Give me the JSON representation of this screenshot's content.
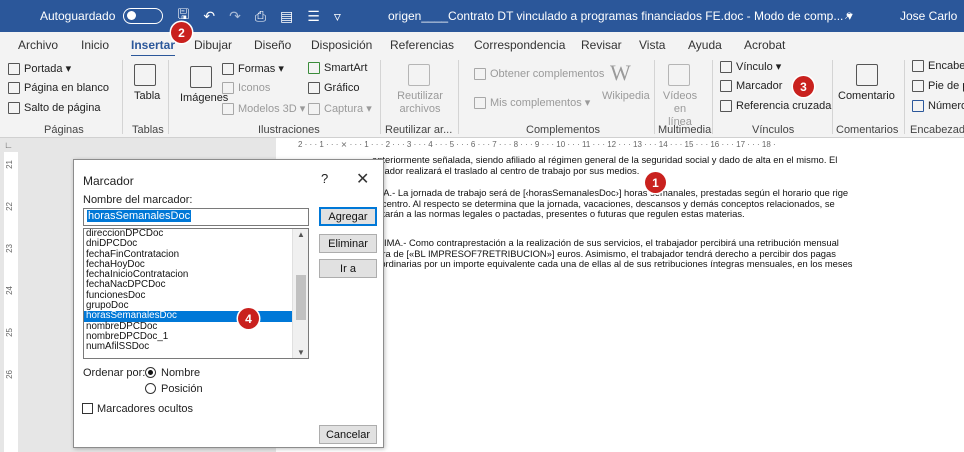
{
  "titlebar": {
    "autosave": "Autoguardado",
    "doc_title": "origen____Contrato DT vinculado a programas financiados FE.doc  -  Modo de comp...  ▾",
    "user": "Jose Carlo"
  },
  "tabs": [
    "Archivo",
    "Inicio",
    "Insertar",
    "Dibujar",
    "Diseño",
    "Disposición",
    "Referencias",
    "Correspondencia",
    "Revisar",
    "Vista",
    "Ayuda",
    "Acrobat"
  ],
  "ribbon": {
    "paginas": {
      "portada": "Portada ▾",
      "pagina_blanco": "Página en blanco",
      "salto": "Salto de página",
      "label": "Páginas"
    },
    "tablas": {
      "tabla": "Tabla",
      "label": "Tablas"
    },
    "ilustraciones": {
      "imagenes": "Imágenes",
      "formas": "Formas ▾",
      "iconos": "Iconos",
      "modelos": "Modelos 3D ▾",
      "smartart": "SmartArt",
      "grafico": "Gráfico",
      "captura": "Captura ▾",
      "label": "Ilustraciones"
    },
    "reutilizar": {
      "btn": "Reutilizar archivos",
      "label": "Reutilizar ar..."
    },
    "complementos": {
      "obtener": "Obtener complementos",
      "mis": "Mis complementos ▾",
      "wikipedia": "Wikipedia",
      "label": "Complementos"
    },
    "multimedia": {
      "videos": "Vídeos en línea",
      "label": "Multimedia"
    },
    "vinculos": {
      "vinculo": "Vínculo ▾",
      "marcador": "Marcador",
      "referencia": "Referencia cruzada",
      "label": "Vínculos"
    },
    "comentarios": {
      "btn": "Comentario",
      "label": "Comentarios"
    },
    "encabezado": {
      "encabez": "Encabez",
      "pie": "Pie de p",
      "numero": "Número",
      "label": "Encabezado y"
    }
  },
  "ruler": {
    "h": "2 · · · 1 · · · ⨯ · · · 1 · · · 2 · · · 3 · · · 4 · · · 5 · · · 6 · · · 7 · · · 8 · · · 9 · · · 10 · · · 11 · · · 12 · · · 13 · · · 14 · · · 15 · · · 16 · · · 17 · · · 18 ·",
    "v": [
      "21",
      "22",
      "23",
      "24",
      "25",
      "26"
    ]
  },
  "document": {
    "para1": [
      "anteriormente señalada, siendo afiliado al régimen general de la seguridad social y dado de alta en el mismo. El",
      "bajador realizará el traslado al centro de trabajo por sus medios."
    ],
    "para2": [
      "XTA.- La jornada de trabajo será de [‹horasSemanalesDoc›] horas semanales, prestadas según el horario que rige",
      "el centro. Al respecto se determina que la jornada, vacaciones, descansos y demás conceptos relacionados, se",
      "aptarán a las normas legales o pactadas, presentes o futuras que regulen estas materias."
    ],
    "para3": [
      "PTIMA.- Como contraprestación a la realización de sus servicios, el trabajador percibirá una retribución mensual",
      "egra de [«BL IMPRESOF7RETRIBUCION»] euros. Asimismo, el trabajador tendrá derecho a percibir dos pagas",
      "raordinarias por un importe equivalente cada una de ellas al de sus retribuciones íntegras mensuales, en los meses"
    ]
  },
  "dialog": {
    "title": "Marcador",
    "help": "?",
    "close": "✕",
    "name_label": "Nombre del marcador:",
    "name_value": "horasSemanalesDoc",
    "items": [
      "direccionDPCDoc",
      "dniDPCDoc",
      "fechaFinContratacion",
      "fechaHoyDoc",
      "fechaInicioContratacion",
      "fechaNacDPCDoc",
      "funcionesDoc",
      "grupoDoc",
      "horasSemanalesDoc",
      "nombreDPCDoc",
      "nombreDPCDoc_1",
      "numAfilSSDoc"
    ],
    "selected": "horasSemanalesDoc",
    "agregar": "Agregar",
    "eliminar": "Eliminar",
    "ira": "Ir a",
    "ordenar": "Ordenar por:",
    "nombre": "Nombre",
    "posicion": "Posición",
    "ocultos": "Marcadores ocultos",
    "cancelar": "Cancelar"
  },
  "callouts": [
    "1",
    "2",
    "3",
    "4"
  ],
  "colors": {
    "accent": "#2b579a",
    "selection": "#0078d7",
    "callout": "#c9211e"
  }
}
